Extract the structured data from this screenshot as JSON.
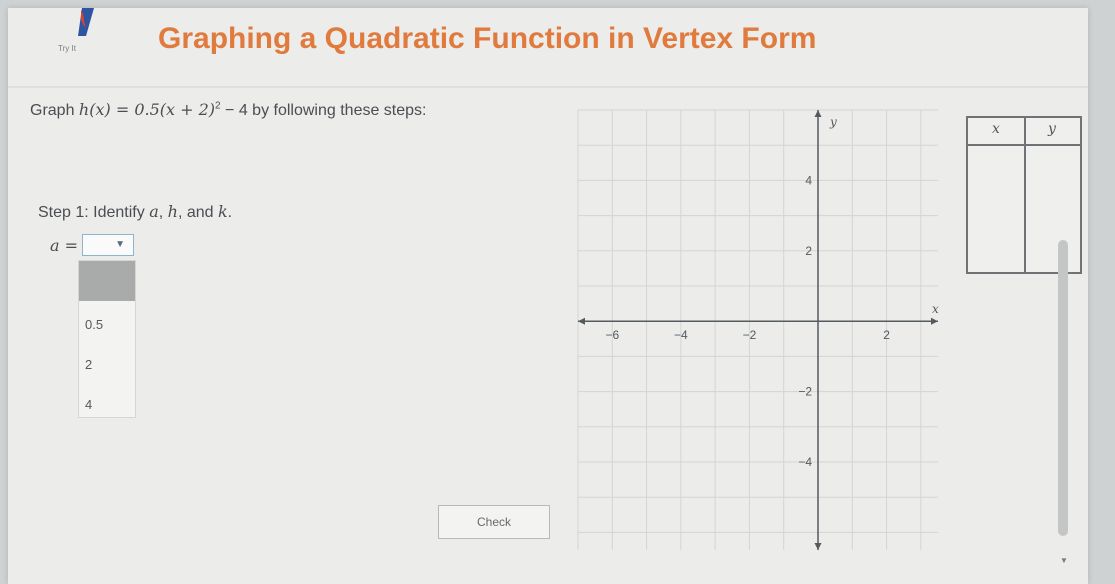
{
  "header": {
    "title": "Graphing a Quadratic Function in Vertex Form",
    "logo_label": "Try It",
    "logo_icon": "pen-icon"
  },
  "prompt": {
    "lead": "Graph ",
    "function": "h(x) = 0.5(x + 2)",
    "exponent": "2",
    "tail": " − 4 by following these steps:"
  },
  "step1": {
    "label": "Step 1: Identify ",
    "v1": "a",
    "sep1": ", ",
    "v2": "h",
    "sep2": ", and ",
    "v3": "k",
    "end": "."
  },
  "a_field": {
    "label": "a =",
    "caret": "▼",
    "options": [
      "0.5",
      "2",
      "4"
    ]
  },
  "check_button": {
    "label": "Check"
  },
  "graph": {
    "x_axis_label": "x",
    "y_axis_label": "y",
    "x_ticks": [
      {
        "value": -6,
        "label": "−6"
      },
      {
        "value": -4,
        "label": "−4"
      },
      {
        "value": -2,
        "label": "−2"
      },
      {
        "value": 2,
        "label": "2"
      }
    ],
    "y_ticks": [
      {
        "value": 4,
        "label": "4"
      },
      {
        "value": 2,
        "label": "2"
      },
      {
        "value": -2,
        "label": "−2"
      },
      {
        "value": -4,
        "label": "−4"
      }
    ],
    "x_range": [
      -7,
      3.5
    ],
    "y_range": [
      -6.5,
      6
    ]
  },
  "xy_table": {
    "x_header": "x",
    "y_header": "y"
  },
  "colors": {
    "title": "#e07a3d",
    "grid": "#d3d5d4",
    "axis": "#555a5e",
    "select_border": "#8fb3c7"
  }
}
